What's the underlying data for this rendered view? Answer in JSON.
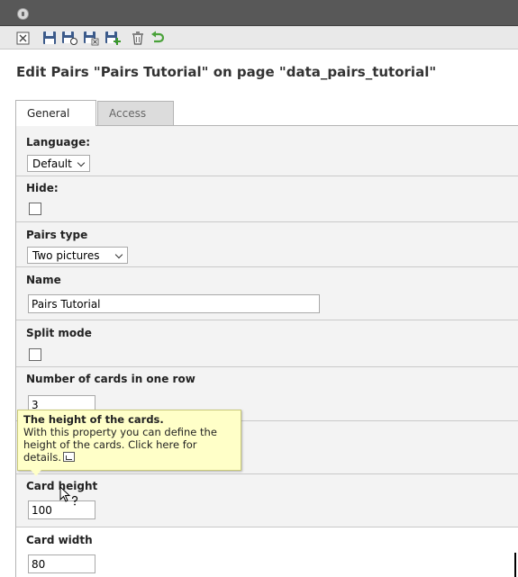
{
  "toolbar": {
    "icons": [
      "close-icon",
      "save-icon",
      "save-and-view-icon",
      "save-and-close-icon",
      "save-and-new-icon",
      "delete-icon",
      "undo-icon"
    ]
  },
  "page": {
    "title": "Edit Pairs \"Pairs Tutorial\" on page \"data_pairs_tutorial\""
  },
  "tabs": [
    {
      "label": "General",
      "active": true
    },
    {
      "label": "Access",
      "active": false
    }
  ],
  "fields": {
    "language": {
      "label": "Language:",
      "value": "Default"
    },
    "hide": {
      "label": "Hide:",
      "checked": false
    },
    "pairs_type": {
      "label": "Pairs type",
      "value": "Two pictures"
    },
    "name": {
      "label": "Name",
      "value": "Pairs Tutorial"
    },
    "split_mode": {
      "label": "Split mode",
      "checked": false
    },
    "cards_in_row": {
      "label": "Number of cards in one row",
      "value": "3"
    },
    "card_height": {
      "label": "Card height",
      "value": "100"
    },
    "card_width": {
      "label": "Card width",
      "value": "80"
    }
  },
  "tooltip": {
    "title": "The height of the cards.",
    "body": "With this property you can define the height of the cards. Click here for details."
  },
  "colors": {
    "topbar": "#585858",
    "toolbar": "#e9e9e9",
    "tooltip_bg": "#ffffc8",
    "save_icon": "#3b5a8a",
    "undo_icon": "#4aa23a"
  }
}
